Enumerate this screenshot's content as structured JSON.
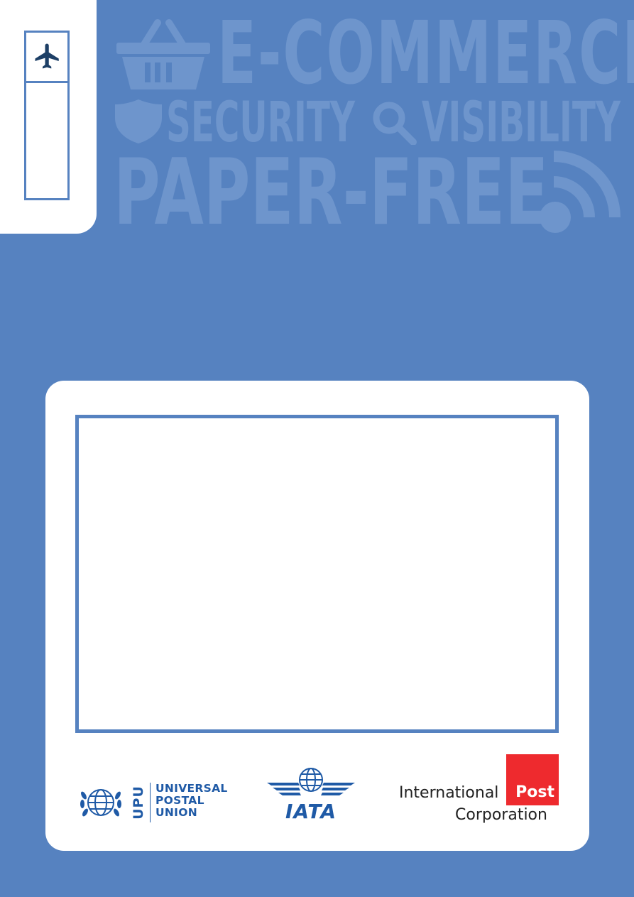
{
  "watermark": {
    "line1": "E-COMMERCE",
    "security": "SECURITY",
    "visibility": "VISIBILITY",
    "line3": "PAPER-FREE",
    "color": "#6e95cc"
  },
  "logos": {
    "upu": {
      "abbr": "UPU",
      "line1": "UNIVERSAL",
      "line2": "POSTAL",
      "line3": "UNION"
    },
    "iata": {
      "name": "IATA"
    },
    "ipc": {
      "line1": "International",
      "post": "Post",
      "line2": "Corporation"
    }
  },
  "colors": {
    "background": "#5682c0",
    "upu_blue": "#1f5aa6",
    "ipc_red": "#ee2a2e"
  },
  "icons": [
    "airplane-icon",
    "shopping-basket-icon",
    "shield-icon",
    "magnifier-icon",
    "rss-feed-icon",
    "un-emblem-icon",
    "iata-globe-wings-icon"
  ]
}
